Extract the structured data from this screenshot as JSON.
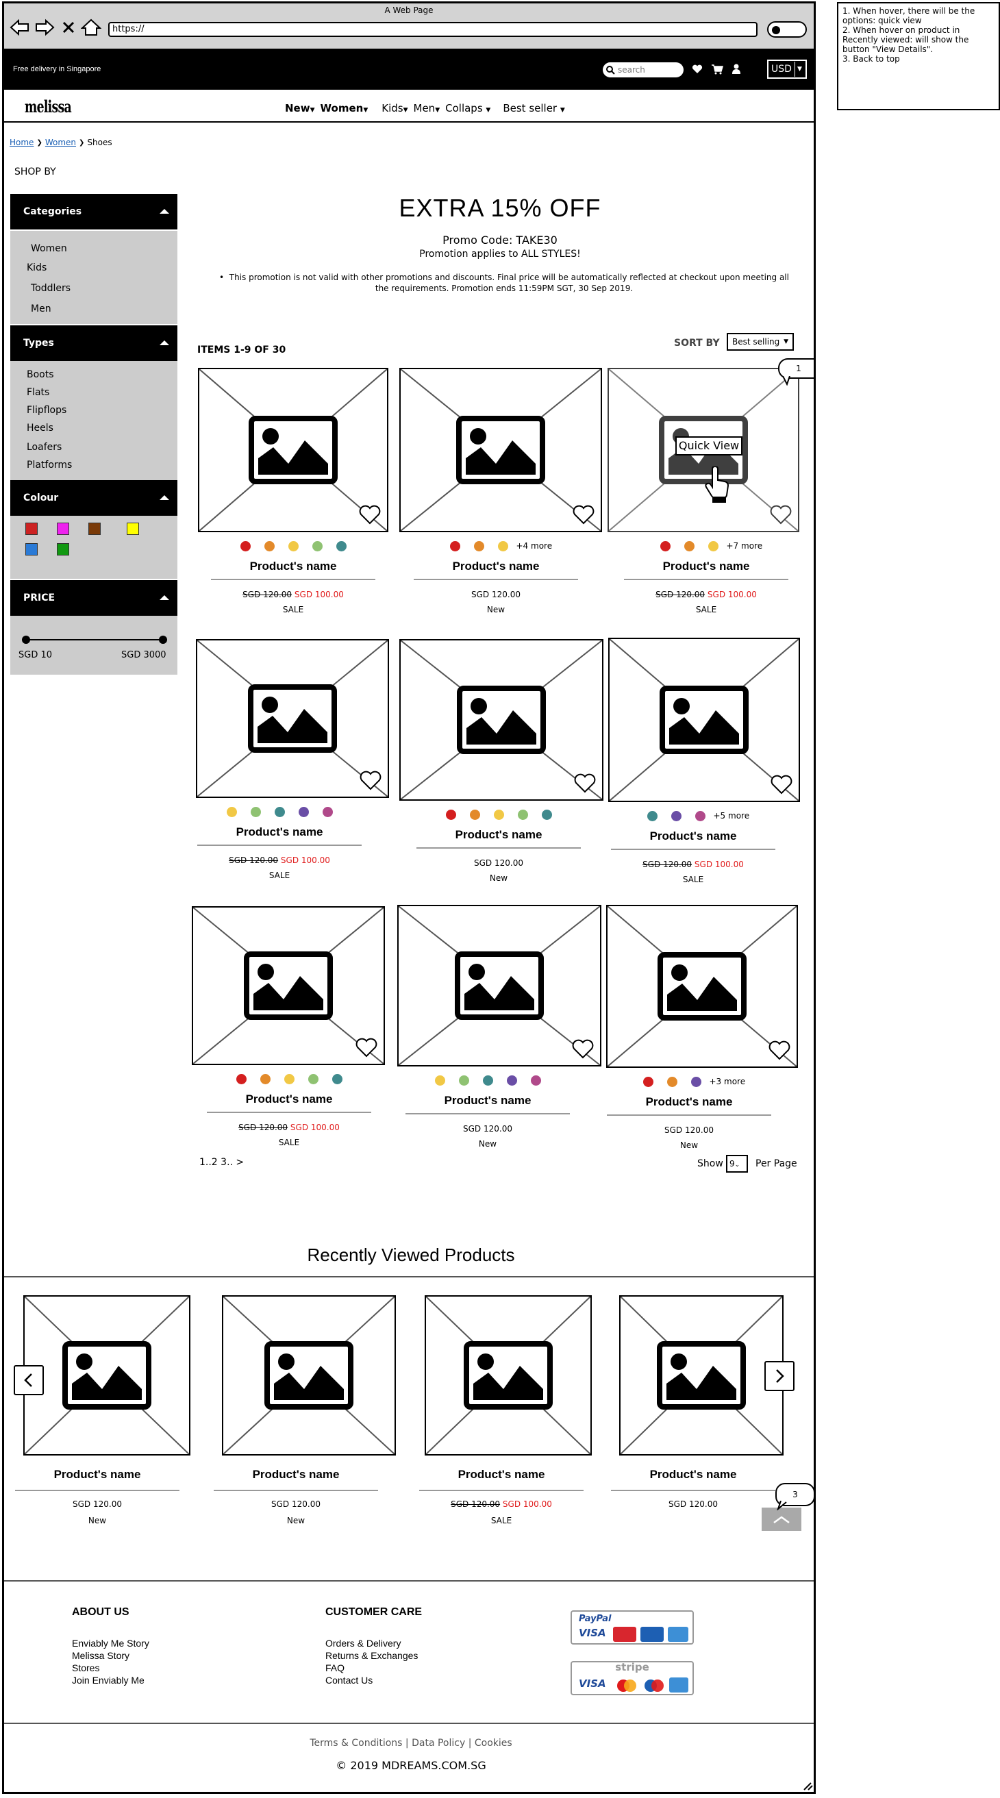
{
  "window": {
    "title": "A Web Page",
    "url": "https://"
  },
  "topbar": {
    "delivery": "Free delivery in Singapore",
    "search_placeholder": "search",
    "currency": "USD"
  },
  "logo": "melissa",
  "nav": [
    "New",
    "Women",
    "Kids",
    "Men",
    "Collaps",
    "Best seller"
  ],
  "breadcrumb": {
    "home": "Home",
    "women": "Women",
    "current": "Shoes"
  },
  "shop_by": "SHOP BY",
  "sidebar": {
    "categories": {
      "title": "Categories",
      "items": [
        "Women",
        "Kids",
        "Toddlers",
        "Men"
      ]
    },
    "types": {
      "title": "Types",
      "items": [
        "Boots",
        "Flats",
        "Flipflops",
        "Heels",
        "Loafers",
        "Platforms"
      ]
    },
    "colour": {
      "title": "Colour",
      "swatches": [
        "#cc2222",
        "#ee22ee",
        "#7a3a08",
        "#ffff00",
        "#2a7ad6",
        "#119911"
      ]
    },
    "price": {
      "title": "PRICE",
      "min": "SGD 10",
      "max": "SGD 3000"
    }
  },
  "promo": {
    "title": "EXTRA 15% OFF",
    "code": "Promo Code: TAKE30",
    "applies": "Promotion applies to ALL STYLES!",
    "note": "This promotion is not valid with other promotions and discounts. Final price will be automatically reflected at checkout upon meeting all the requirements. Promotion ends 11:59PM SGT, 30 Sep 2019."
  },
  "listing": {
    "items_count": "ITEMS 1-9 OF 30",
    "sort_label": "SORT BY",
    "sort_value": "Best selling"
  },
  "products": [
    {
      "name": "Product's name",
      "colors": [
        "#d41f1f",
        "#e38a2a",
        "#f1c845",
        "#8fc272",
        "#3f8a8d"
      ],
      "more": "",
      "old_price": "SGD 120.00",
      "price": "SGD 100.00",
      "label": "SALE"
    },
    {
      "name": "Product's name",
      "colors": [
        "#d41f1f",
        "#e38a2a",
        "#f1c845"
      ],
      "more": "+4 more",
      "old_price": "",
      "price": "SGD 120.00",
      "label": "New"
    },
    {
      "name": "Product's name",
      "colors": [
        "#d41f1f",
        "#e38a2a",
        "#f1c845"
      ],
      "more": "+7 more",
      "old_price": "SGD 120.00",
      "price": "SGD 100.00",
      "label": "SALE"
    },
    {
      "name": "Product's name",
      "colors": [
        "#f1c845",
        "#8fc272",
        "#3f8a8d",
        "#6a4ea6",
        "#b0498a"
      ],
      "more": "",
      "old_price": "SGD 120.00",
      "price": "SGD 100.00",
      "label": "SALE"
    },
    {
      "name": "Product's name",
      "colors": [
        "#d41f1f",
        "#e38a2a",
        "#f1c845",
        "#8fc272",
        "#3f8a8d"
      ],
      "more": "",
      "old_price": "",
      "price": "SGD 120.00",
      "label": "New"
    },
    {
      "name": "Product's name",
      "colors": [
        "#3f8a8d",
        "#6a4ea6",
        "#b0498a"
      ],
      "more": "+5 more",
      "old_price": "SGD 120.00",
      "price": "SGD 100.00",
      "label": "SALE"
    },
    {
      "name": "Product's name",
      "colors": [
        "#d41f1f",
        "#e38a2a",
        "#f1c845",
        "#8fc272",
        "#3f8a8d"
      ],
      "more": "",
      "old_price": "SGD 120.00",
      "price": "SGD 100.00",
      "label": "SALE"
    },
    {
      "name": "Product's name",
      "colors": [
        "#f1c845",
        "#8fc272",
        "#3f8a8d",
        "#6a4ea6",
        "#b0498a"
      ],
      "more": "",
      "old_price": "",
      "price": "SGD 120.00",
      "label": "New"
    },
    {
      "name": "Product's name",
      "colors": [
        "#d41f1f",
        "#e38a2a",
        "#6a4ea6"
      ],
      "more": "+3 more",
      "old_price": "",
      "price": "SGD 120.00",
      "label": "New"
    }
  ],
  "quick_view": "Quick View",
  "bubbles": {
    "one": "1",
    "three": "3"
  },
  "pagination": {
    "pages": "1..2 3.. >",
    "show_label": "Show",
    "show_value": "9",
    "per_page": "Per Page"
  },
  "recently_viewed": {
    "title": "Recently Viewed Products",
    "items": [
      {
        "name": "Product's name",
        "old_price": "",
        "price": "SGD 120.00",
        "label": "New"
      },
      {
        "name": "Product's name",
        "old_price": "",
        "price": "SGD 120.00",
        "label": "New"
      },
      {
        "name": "Product's name",
        "old_price": "SGD 120.00",
        "price": "SGD 100.00",
        "label": "SALE"
      },
      {
        "name": "Product's name",
        "old_price": "",
        "price": "SGD 120.00",
        "label": ""
      }
    ]
  },
  "footer": {
    "about": {
      "title": "ABOUT US",
      "links": [
        "Enviably Me Story",
        "Melissa Story",
        "Stores",
        "Join Enviably Me"
      ]
    },
    "care": {
      "title": "CUSTOMER CARE",
      "links": [
        "Orders & Delivery",
        "Returns & Exchanges",
        "FAQ",
        "Contact Us"
      ]
    },
    "payments": {
      "paypal": "PayPal",
      "stripe": "stripe",
      "visa": "VISA"
    },
    "legal": "Terms & Conditions | Data Policy | Cookies",
    "copyright": "© 2019 MDREAMS.COM.SG"
  },
  "notes": "1. When hover, there will be the options: quick view\n2. When hover on product in Recently viewed: will show the button \"View Details\".\n3. Back to top"
}
